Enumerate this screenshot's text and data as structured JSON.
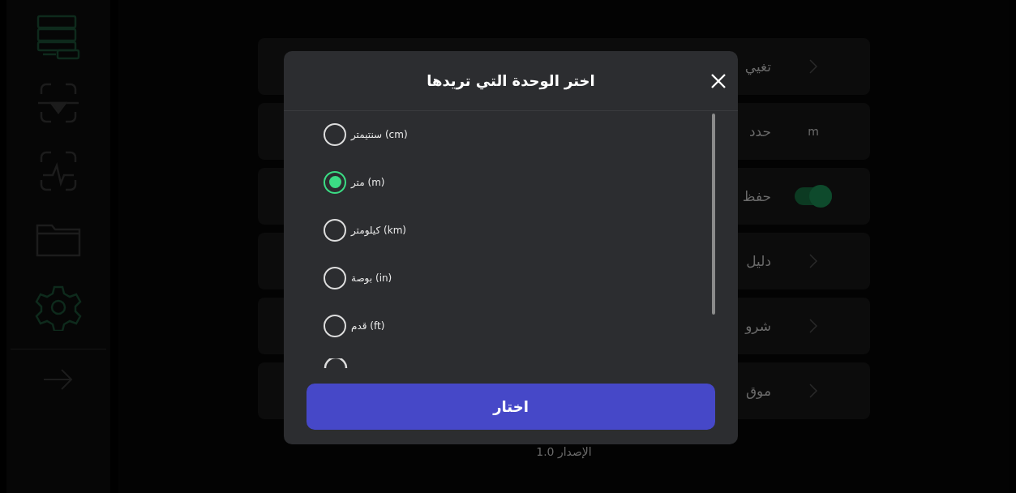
{
  "sidebar": {
    "items": [
      {
        "kind": "face",
        "selected": false
      },
      {
        "kind": "pulse",
        "selected": false
      },
      {
        "kind": "folder",
        "selected": false
      },
      {
        "kind": "gear",
        "selected": true
      }
    ]
  },
  "settings": {
    "rows": [
      {
        "label": "تغيي",
        "kind": "link"
      },
      {
        "label": "حدد",
        "kind": "value",
        "value": "m"
      },
      {
        "label": "حفظ",
        "kind": "toggle",
        "on": true
      },
      {
        "label": "دليل",
        "kind": "link"
      },
      {
        "label": "شرو",
        "kind": "link"
      },
      {
        "label": "موق",
        "kind": "link"
      }
    ],
    "version": "الإصدار 1.0"
  },
  "dialog": {
    "title": "اختر الوحدة التي تريدها",
    "options": [
      {
        "label": "سنتيمتر (cm)",
        "selected": false
      },
      {
        "label": "متر (m)",
        "selected": true
      },
      {
        "label": "كيلومتر (km)",
        "selected": false
      },
      {
        "label": "بوصة (in)",
        "selected": false
      },
      {
        "label": "قدم (ft)",
        "selected": false
      }
    ],
    "button": "اختار"
  }
}
